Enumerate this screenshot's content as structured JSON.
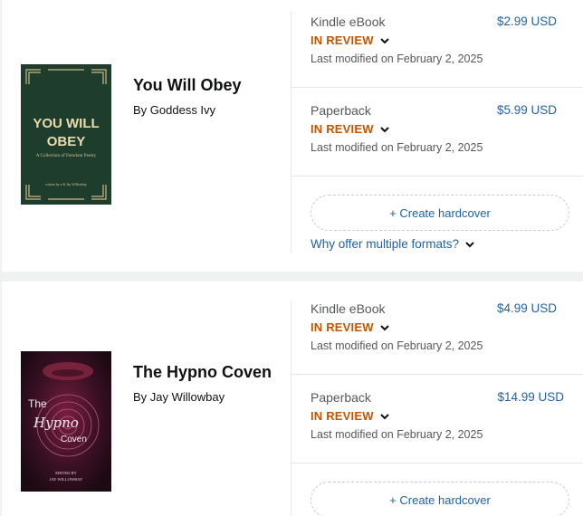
{
  "books": [
    {
      "title": "You Will Obey",
      "author": "By Goddess Ivy",
      "cover": {
        "heading_line1": "YOU WILL",
        "heading_line2": "OBEY",
        "subtitle": "A Collection of Femdom Poetry",
        "credit": "written by x & Jay Willowbay",
        "bg_color": "#1f3d2c",
        "accent_color": "#c9b98a"
      },
      "formats": [
        {
          "name": "Kindle eBook",
          "status": "IN REVIEW",
          "modified": "Last modified on February 2, 2025",
          "price": "$2.99 USD"
        },
        {
          "name": "Paperback",
          "status": "IN REVIEW",
          "modified": "Last modified on February 2, 2025",
          "price": "$5.99 USD"
        }
      ],
      "create_hardcover": "+ Create hardcover",
      "why_link": "Why offer multiple formats?"
    },
    {
      "title": "The Hypno Coven",
      "author": "By Jay Willowbay",
      "cover": {
        "title_the": "The",
        "title_hypno": "Hypno",
        "title_coven": "Coven",
        "credit_line1": "EDITED BY",
        "credit_line2": "JAY WILLOWBAY",
        "bg_color": "#2a0f1c"
      },
      "formats": [
        {
          "name": "Kindle eBook",
          "status": "IN REVIEW",
          "modified": "Last modified on February 2, 2025",
          "price": "$4.99 USD"
        },
        {
          "name": "Paperback",
          "status": "IN REVIEW",
          "modified": "Last modified on February 2, 2025",
          "price": "$14.99 USD"
        }
      ],
      "create_hardcover": "+ Create hardcover"
    }
  ],
  "colors": {
    "status": "#c45500",
    "link": "#2162a1",
    "muted": "#565959",
    "text": "#0f1111"
  }
}
